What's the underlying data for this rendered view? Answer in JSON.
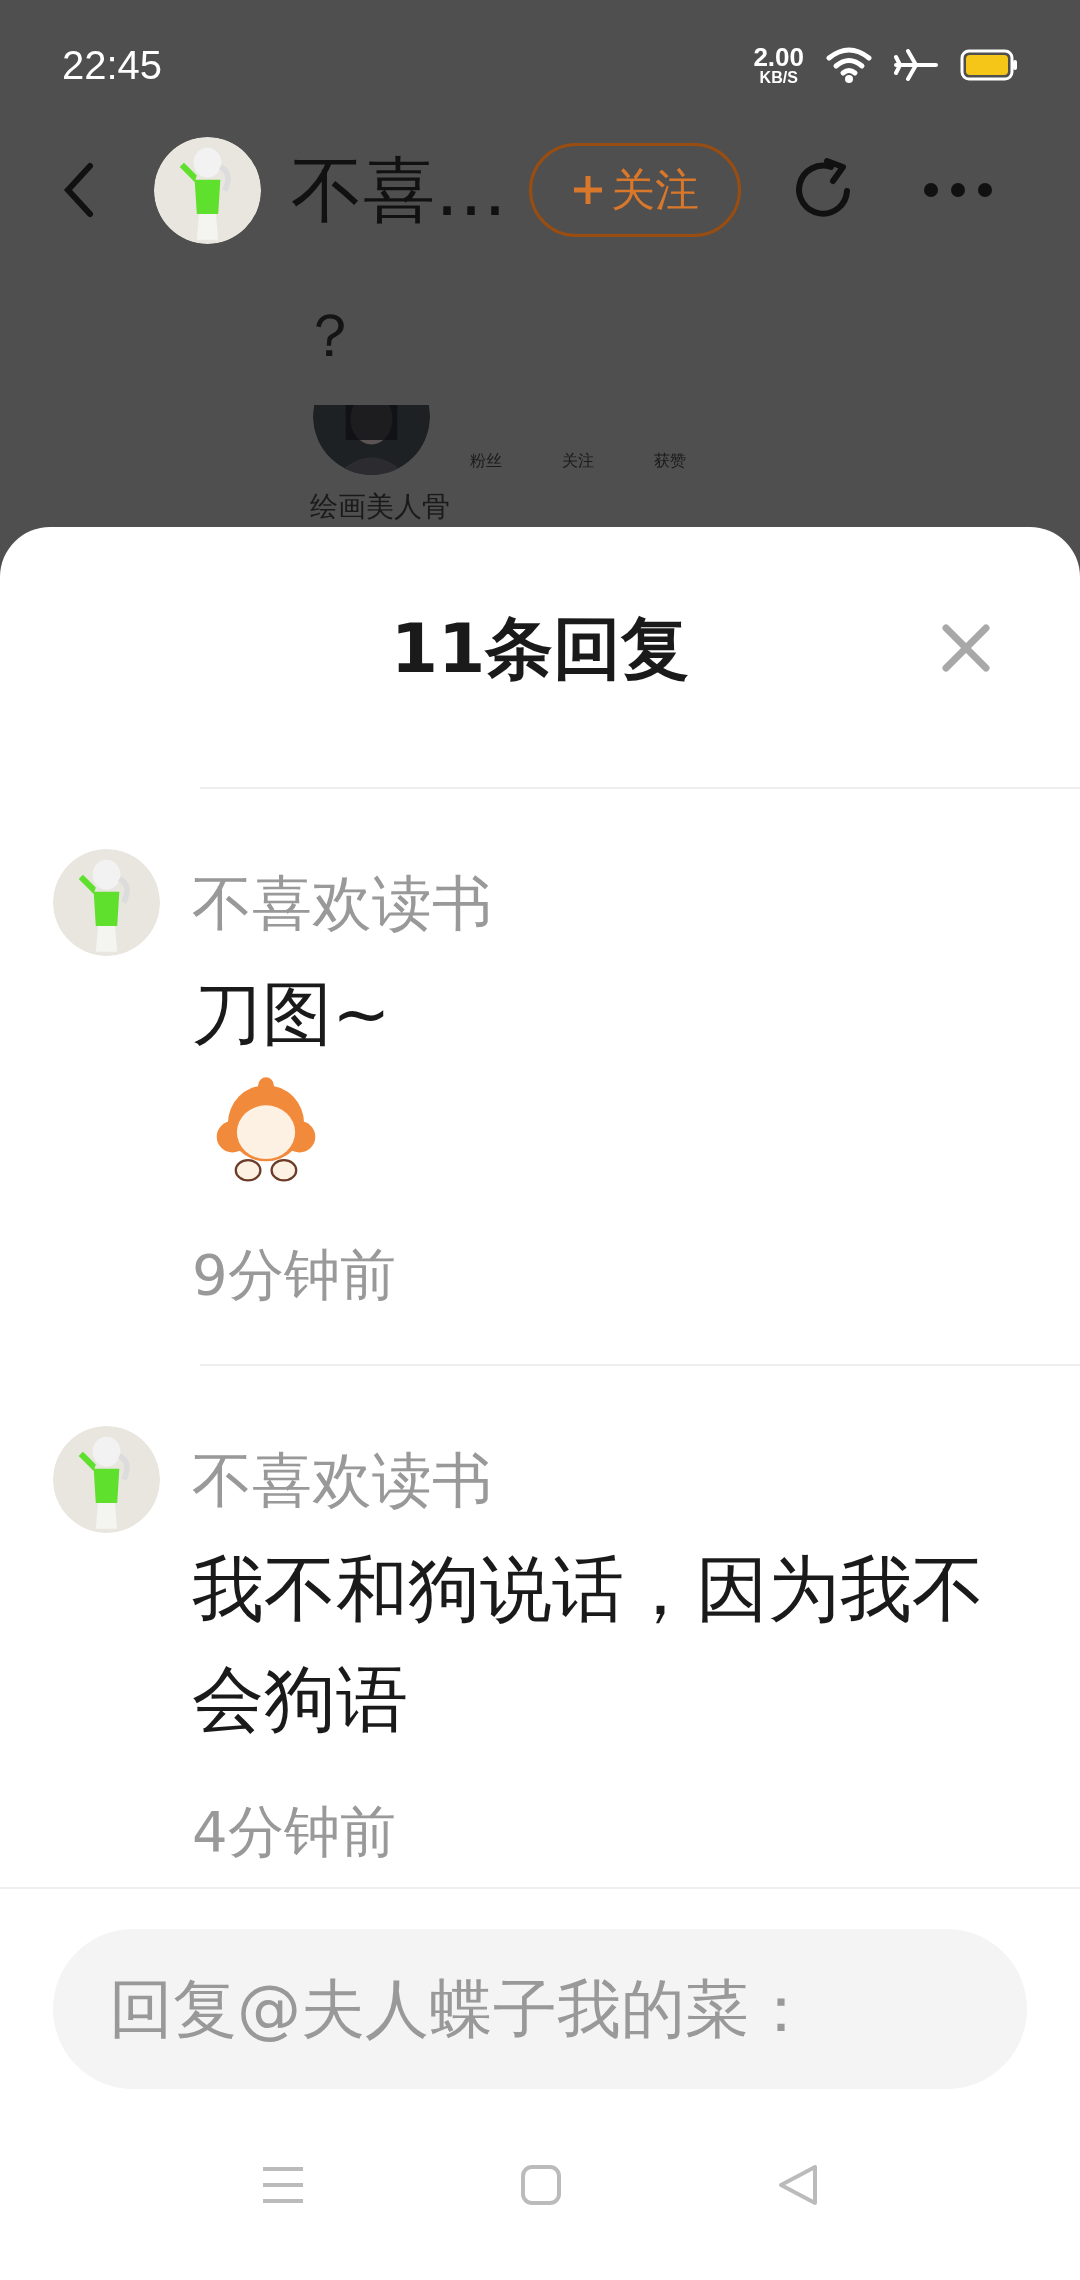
{
  "status_bar": {
    "time": "22:45",
    "net_speed": "2.00",
    "net_unit": "KB/S"
  },
  "header": {
    "title": "不喜…",
    "follow_button": "关注"
  },
  "background_post": {
    "text": "？",
    "stats": [
      "粉丝",
      "关注",
      "获赞"
    ],
    "author": "绘画美人骨"
  },
  "sheet": {
    "title": "11条回复",
    "comments": [
      {
        "author": "不喜欢读书",
        "text": "刀图~",
        "kind": "sticker",
        "time": "9分钟前"
      },
      {
        "author": "不喜欢读书",
        "text": "我不和狗说话，因为我不会狗语",
        "kind": "text",
        "time": "4分钟前"
      }
    ],
    "reply_field": {
      "placeholder": "回复@夫人蝶子我的菜："
    }
  }
}
